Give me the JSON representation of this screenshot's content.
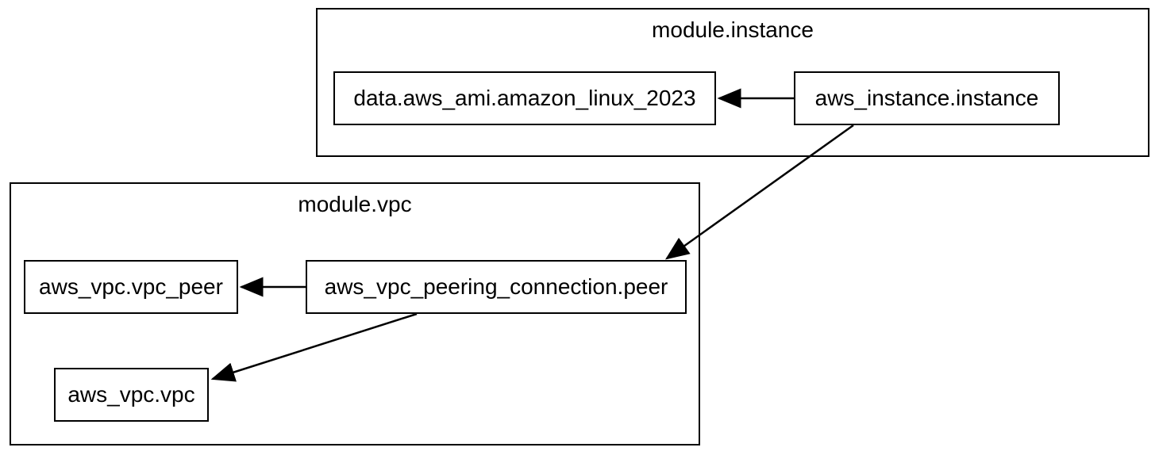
{
  "modules": {
    "instance": {
      "title": "module.instance",
      "resources": {
        "ami": "data.aws_ami.amazon_linux_2023",
        "instance": "aws_instance.instance"
      }
    },
    "vpc": {
      "title": "module.vpc",
      "resources": {
        "vpc_peer": "aws_vpc.vpc_peer",
        "peering": "aws_vpc_peering_connection.peer",
        "vpc": "aws_vpc.vpc"
      }
    }
  },
  "edges": [
    {
      "from": "aws_instance.instance",
      "to": "data.aws_ami.amazon_linux_2023"
    },
    {
      "from": "aws_instance.instance",
      "to": "aws_vpc_peering_connection.peer"
    },
    {
      "from": "aws_vpc_peering_connection.peer",
      "to": "aws_vpc.vpc_peer"
    },
    {
      "from": "aws_vpc_peering_connection.peer",
      "to": "aws_vpc.vpc"
    }
  ]
}
